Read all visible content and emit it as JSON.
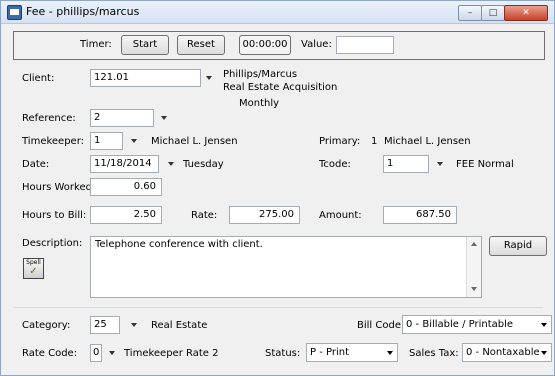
{
  "window": {
    "title": "Fee - phillips/marcus"
  },
  "timer": {
    "label": "Timer:",
    "start_label": "Start",
    "reset_label": "Reset",
    "elapsed": "00:00:00",
    "value_label": "Value:",
    "value": ""
  },
  "client": {
    "label": "Client:",
    "value": "121.01",
    "name": "Phillips/Marcus",
    "matter": "Real Estate Acquisition",
    "frequency": "Monthly"
  },
  "reference": {
    "label": "Reference:",
    "value": "2"
  },
  "timekeeper": {
    "label": "Timekeeper:",
    "value": "1",
    "name": "Michael L. Jensen"
  },
  "primary": {
    "label": "Primary:",
    "value": "1",
    "name": "Michael L. Jensen"
  },
  "date": {
    "label": "Date:",
    "value": "11/18/2014",
    "weekday": "Tuesday"
  },
  "tcode": {
    "label": "Tcode:",
    "value": "1",
    "name": "FEE Normal"
  },
  "hours_worked": {
    "label": "Hours Worked:",
    "value": "0.60"
  },
  "hours_to_bill": {
    "label": "Hours to Bill:",
    "value": "2.50"
  },
  "rate": {
    "label": "Rate:",
    "value": "275.00"
  },
  "amount": {
    "label": "Amount:",
    "value": "687.50"
  },
  "description": {
    "label": "Description:",
    "value": "Telephone conference with client.",
    "spell_label": "Spell",
    "rapid_label": "Rapid"
  },
  "category": {
    "label": "Category:",
    "value": "25",
    "name": "Real Estate"
  },
  "bill_code": {
    "label": "Bill Code:",
    "value": "0 - Billable / Printable"
  },
  "rate_code": {
    "label": "Rate Code:",
    "value": "0",
    "name": "Timekeeper Rate 2"
  },
  "status": {
    "label": "Status:",
    "value": "P - Print"
  },
  "sales_tax": {
    "label": "Sales Tax:",
    "value": "0 - Nontaxable"
  }
}
